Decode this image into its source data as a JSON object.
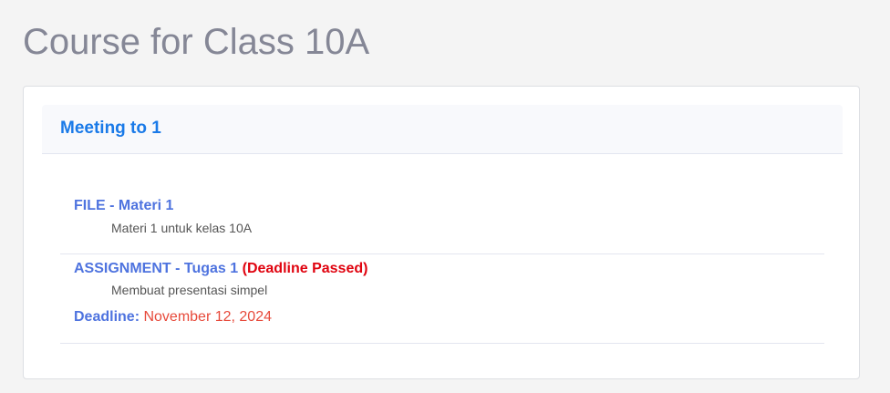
{
  "page": {
    "title": "Course for Class 10A"
  },
  "meeting": {
    "title": "Meeting to 1",
    "items": [
      {
        "title": "FILE - Materi 1",
        "description": "Materi 1 untuk kelas 10A"
      },
      {
        "title": "ASSIGNMENT - Tugas 1",
        "status": "(Deadline Passed)",
        "description": "Membuat presentasi simpel",
        "deadline_label": "Deadline:",
        "deadline_date": "November 12, 2024"
      }
    ]
  },
  "colors": {
    "link": "#4e73df",
    "header_title": "#1a7ae8",
    "deadline_passed": "#e0030f",
    "deadline_date": "#e74a3b"
  }
}
